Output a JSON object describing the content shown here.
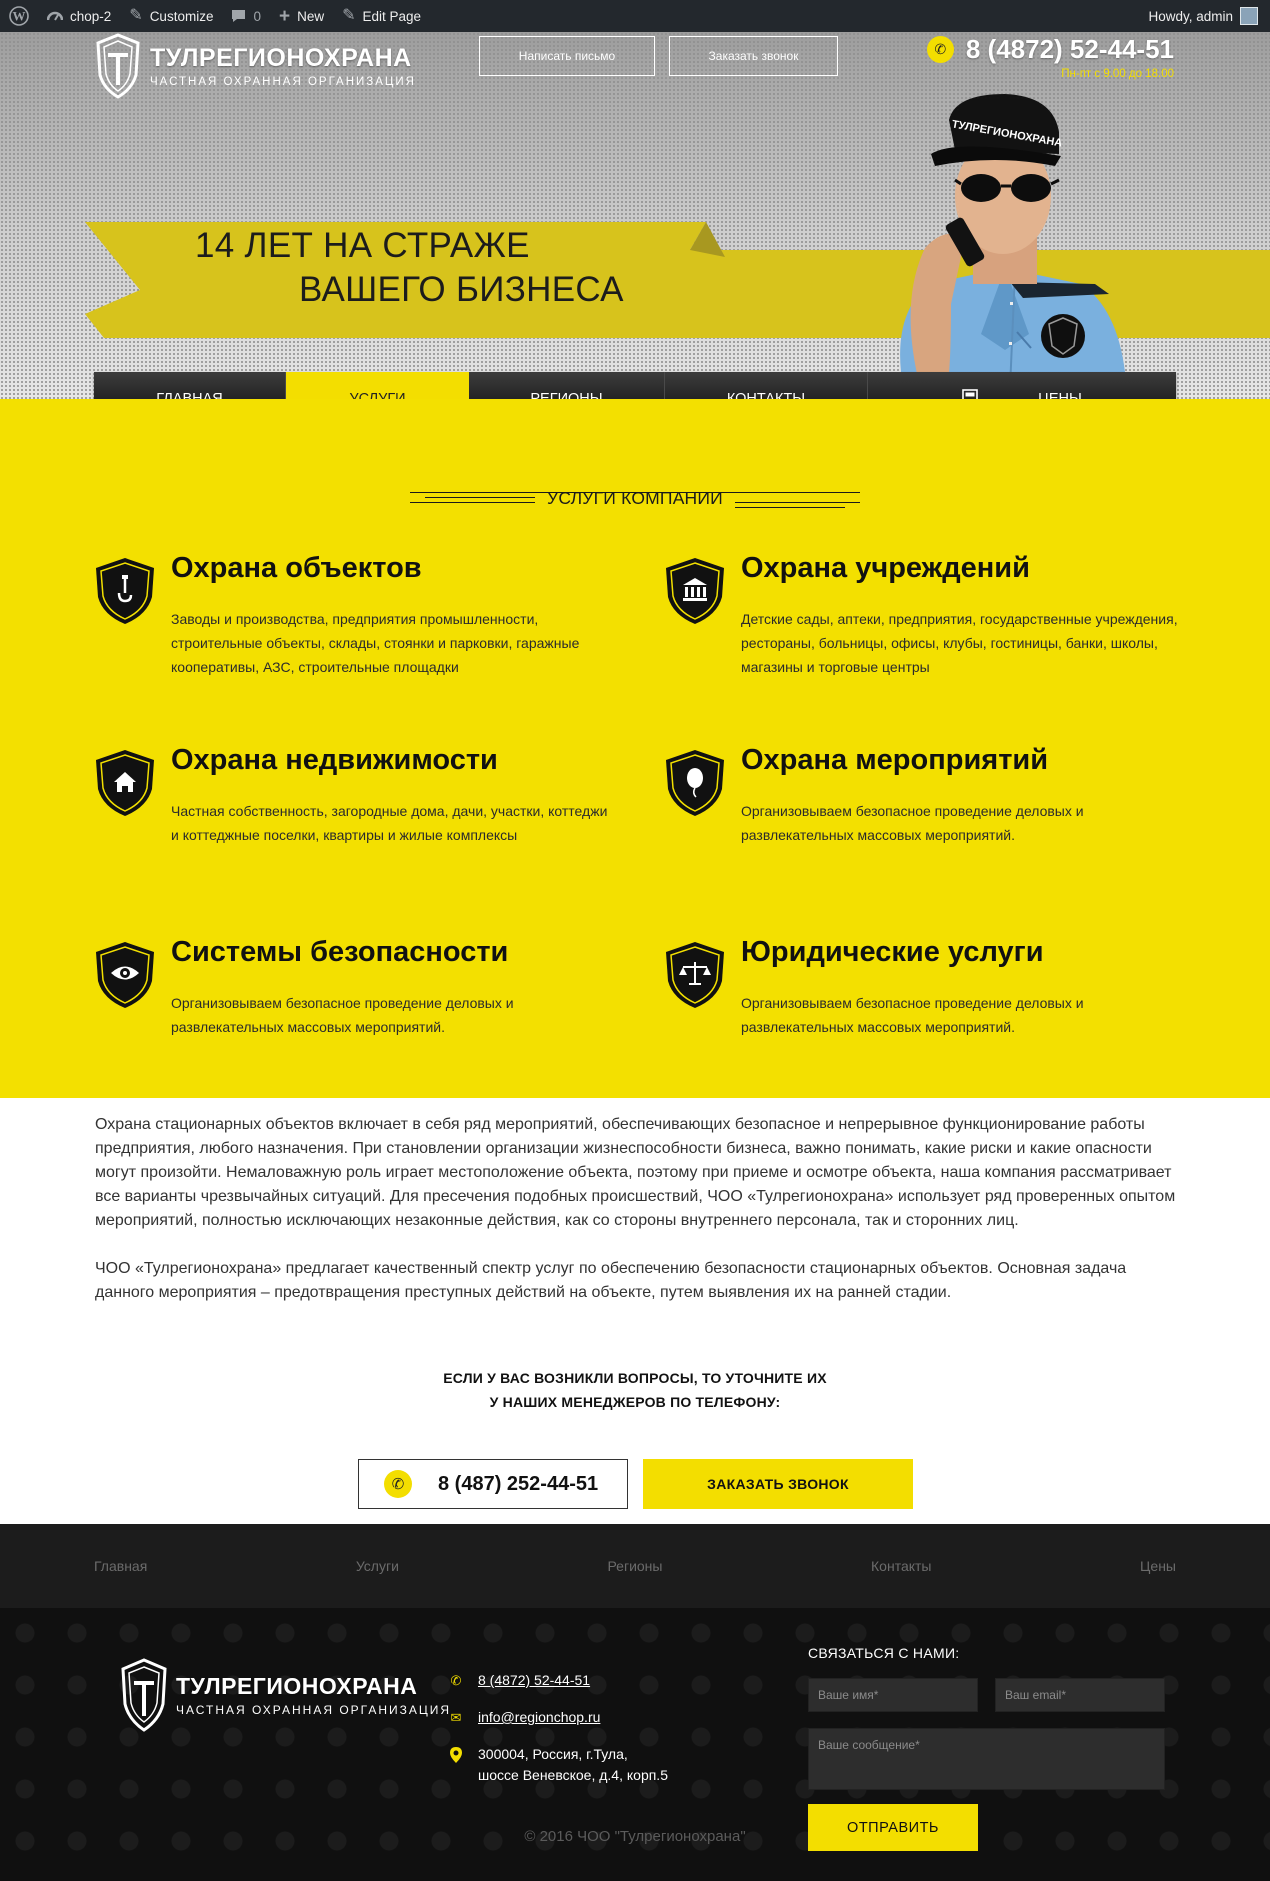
{
  "adminbar": {
    "site_name": "chop-2",
    "customize": "Customize",
    "comments": "0",
    "new": "New",
    "edit_page": "Edit Page",
    "greeting": "Howdy, admin"
  },
  "header": {
    "logo_name": "ТУЛРЕГИОНОХРАНА",
    "logo_sub": "ЧАСТНАЯ ОХРАННАЯ ОРГАНИЗАЦИЯ",
    "btn_letter": "Написать письмо",
    "btn_call": "Заказать звонок",
    "phone": "8 (4872) 52-44-51",
    "hours": "Пн-пт с 9.00 до 18.00",
    "tagline_line1": "14 ЛЕТ НА СТРАЖЕ",
    "tagline_line2": "ВАШЕГО БИЗНЕСА",
    "cap_text": "ТУЛРЕГИОНОХРАНА"
  },
  "nav": {
    "items": [
      {
        "label": "ГЛАВНАЯ"
      },
      {
        "label": "УСЛУГИ"
      },
      {
        "label": "РЕГИОНЫ"
      },
      {
        "label": "КОНТАКТЫ"
      },
      {
        "label": "ЦЕНЫ"
      }
    ],
    "active_index": 1
  },
  "services": {
    "section_title": "УСЛУГИ КОМПАНИИ",
    "items": [
      {
        "title": "Охрана объектов",
        "icon": "hook-icon",
        "text": "Заводы и производства, предприятия промышленности, строительные объекты, склады, стоянки и парковки, гаражные кооперативы, АЗС, строительные площадки"
      },
      {
        "title": "Охрана учреждений",
        "icon": "institution-icon",
        "text": "Детские сады, аптеки, предприятия, государственные учреждения, рестораны, больницы, офисы, клубы, гостиницы, банки, школы, магазины и торговые центры"
      },
      {
        "title": "Охрана недвижимости",
        "icon": "house-icon",
        "text": "Частная собственность, загородные дома, дачи, участки, коттеджи и коттеджные поселки, квартиры и жилые комплексы"
      },
      {
        "title": "Охрана мероприятий",
        "icon": "balloon-icon",
        "text": "Организовываем безопасное проведение деловых и развлекательных массовых мероприятий."
      },
      {
        "title": "Системы безопасности",
        "icon": "eye-icon",
        "text": "Организовываем безопасное проведение деловых и развлекательных массовых мероприятий."
      },
      {
        "title": "Юридические услуги",
        "icon": "scales-icon",
        "text": "Организовываем безопасное проведение деловых и развлекательных массовых мероприятий."
      }
    ]
  },
  "about": {
    "p1": "Охрана стационарных объектов включает в себя ряд мероприятий, обеспечивающих безопасное и непрерывное функционирование работы предприятия, любого назначения. При становлении организации жизнеспособности бизнеса, важно понимать, какие риски и какие опасности могут произойти. Немаловажную роль играет местоположение объекта, поэтому при приеме и осмотре объекта, наша компания рассматривает все варианты чрезвычайных ситуаций. Для пресечения подобных происшествий, ЧОО «Тулрегионохрана» использует ряд проверенных опытом мероприятий, полностью исключающих незаконные действия, как со стороны внутреннего персонала, так и сторонних лиц.",
    "p2": "ЧОО «Тулрегионохрана» предлагает качественный спектр услуг по обеспечению безопасности стационарных объектов. Основная задача данного мероприятия – предотвращения преступных действий на объекте, путем выявления их на ранней стадии."
  },
  "cta": {
    "line1": "ЕСЛИ У ВАС ВОЗНИКЛИ ВОПРОСЫ, ТО УТОЧНИТЕ ИХ",
    "line2": "У НАШИХ МЕНЕДЖЕРОВ ПО ТЕЛЕФОНУ:",
    "phone": "8 (487) 252-44-51",
    "order_button": "ЗАКАЗАТЬ ЗВОНОК"
  },
  "footer_nav": [
    "Главная",
    "Услуги",
    "Регионы",
    "Контакты",
    "Цены"
  ],
  "footer": {
    "logo_name": "ТУЛРЕГИОНОХРАНА",
    "logo_sub": "ЧАСТНАЯ ОХРАННАЯ ОРГАНИЗАЦИЯ",
    "phone": "8 (4872) 52-44-51",
    "email": "info@regionchop.ru",
    "address_line1": "300004, Россия, г.Тула,",
    "address_line2": "шоссе Веневское, д.4, корп.5",
    "form_title": "СВЯЗАТЬСЯ С НАМИ:",
    "name_placeholder": "Ваше имя*",
    "email_placeholder": "Ваш email*",
    "message_placeholder": "Ваше сообщение*",
    "submit": "ОТПРАВИТЬ",
    "copyright": "© 2016 ЧОО \"Тулрегионохрана\""
  },
  "colors": {
    "accent": "#f3de00",
    "dark": "#101010",
    "admin_bar": "#23282d"
  }
}
